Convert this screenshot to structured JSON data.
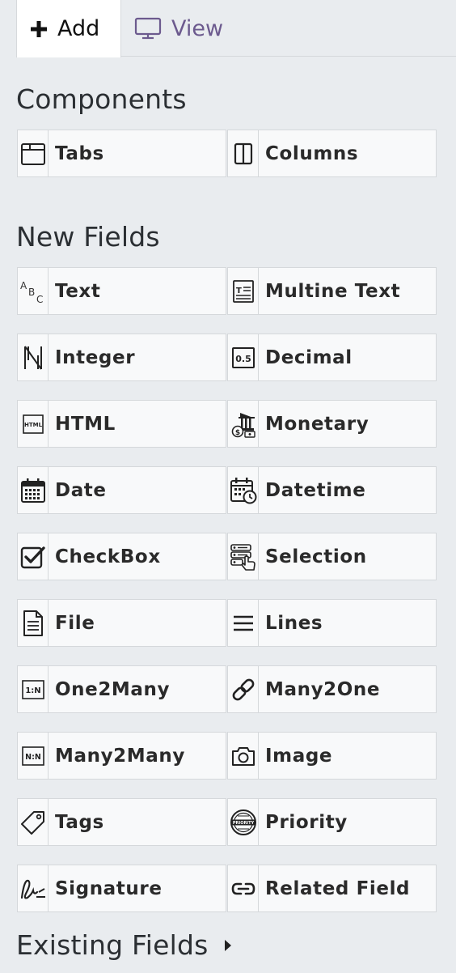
{
  "tabs": {
    "add_label": "Add",
    "view_label": "View"
  },
  "sections": {
    "components": "Components",
    "new_fields": "New Fields",
    "existing_fields": "Existing Fields"
  },
  "components": [
    {
      "label": "Tabs",
      "icon": "tabs-icon"
    },
    {
      "label": "Columns",
      "icon": "columns-icon"
    }
  ],
  "new_fields": [
    {
      "label": "Text",
      "icon": "text-abc-icon"
    },
    {
      "label": "Multine Text",
      "icon": "multiline-text-icon"
    },
    {
      "label": "Integer",
      "icon": "integer-n-icon"
    },
    {
      "label": "Decimal",
      "icon": "decimal-icon"
    },
    {
      "label": "HTML",
      "icon": "html-icon"
    },
    {
      "label": "Monetary",
      "icon": "monetary-bank-icon"
    },
    {
      "label": "Date",
      "icon": "calendar-icon"
    },
    {
      "label": "Datetime",
      "icon": "calendar-clock-icon"
    },
    {
      "label": "CheckBox",
      "icon": "checkbox-icon"
    },
    {
      "label": "Selection",
      "icon": "selection-list-icon"
    },
    {
      "label": "File",
      "icon": "file-icon"
    },
    {
      "label": "Lines",
      "icon": "lines-icon"
    },
    {
      "label": "One2Many",
      "icon": "one-to-many-icon"
    },
    {
      "label": "Many2One",
      "icon": "link-icon"
    },
    {
      "label": "Many2Many",
      "icon": "many-to-many-icon"
    },
    {
      "label": "Image",
      "icon": "camera-icon"
    },
    {
      "label": "Tags",
      "icon": "tag-icon"
    },
    {
      "label": "Priority",
      "icon": "priority-badge-icon"
    },
    {
      "label": "Signature",
      "icon": "signature-icon"
    },
    {
      "label": "Related Field",
      "icon": "related-link-icon"
    }
  ],
  "colors": {
    "background": "#e9ecef",
    "card": "#f8f9fa",
    "view_tab": "#6c5a8e"
  }
}
